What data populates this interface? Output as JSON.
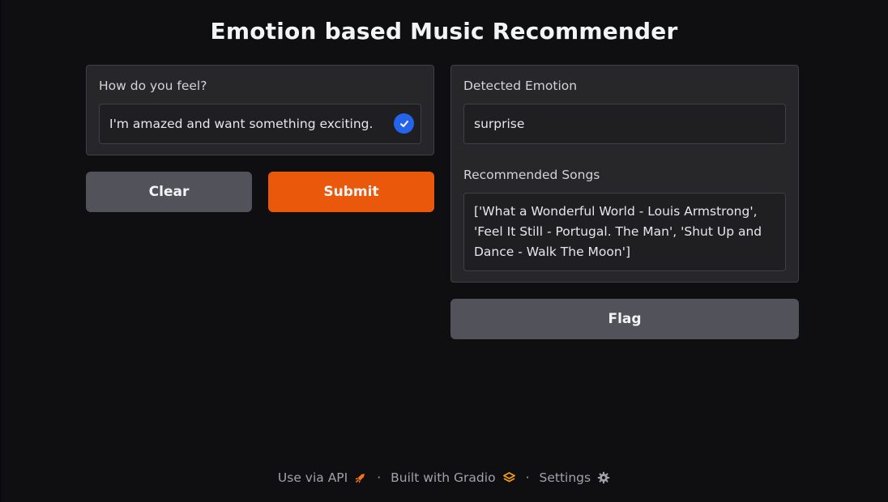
{
  "app": {
    "title": "Emotion based Music Recommender"
  },
  "input": {
    "label": "How do you feel?",
    "value": "I'm amazed and want something exciting."
  },
  "buttons": {
    "clear": "Clear",
    "submit": "Submit",
    "flag": "Flag"
  },
  "output": {
    "emotion_label": "Detected Emotion",
    "emotion_value": "surprise",
    "songs_label": "Recommended Songs",
    "songs_value": "['What a Wonderful World - Louis Armstrong', 'Feel It Still - Portugal. The Man', 'Shut Up and Dance - Walk The Moon']"
  },
  "footer": {
    "api_label": "Use via API",
    "built_label": "Built with Gradio",
    "settings_label": "Settings",
    "separator": "·"
  },
  "colors": {
    "background": "#0f0f11",
    "panel": "#27272a",
    "primary": "#ea580c",
    "secondary": "#52525b",
    "check": "#2563eb"
  },
  "icons": {
    "check": "checkmark-icon",
    "api": "rocket-icon",
    "gradio": "gradio-logo-icon",
    "settings": "gear-icon"
  }
}
